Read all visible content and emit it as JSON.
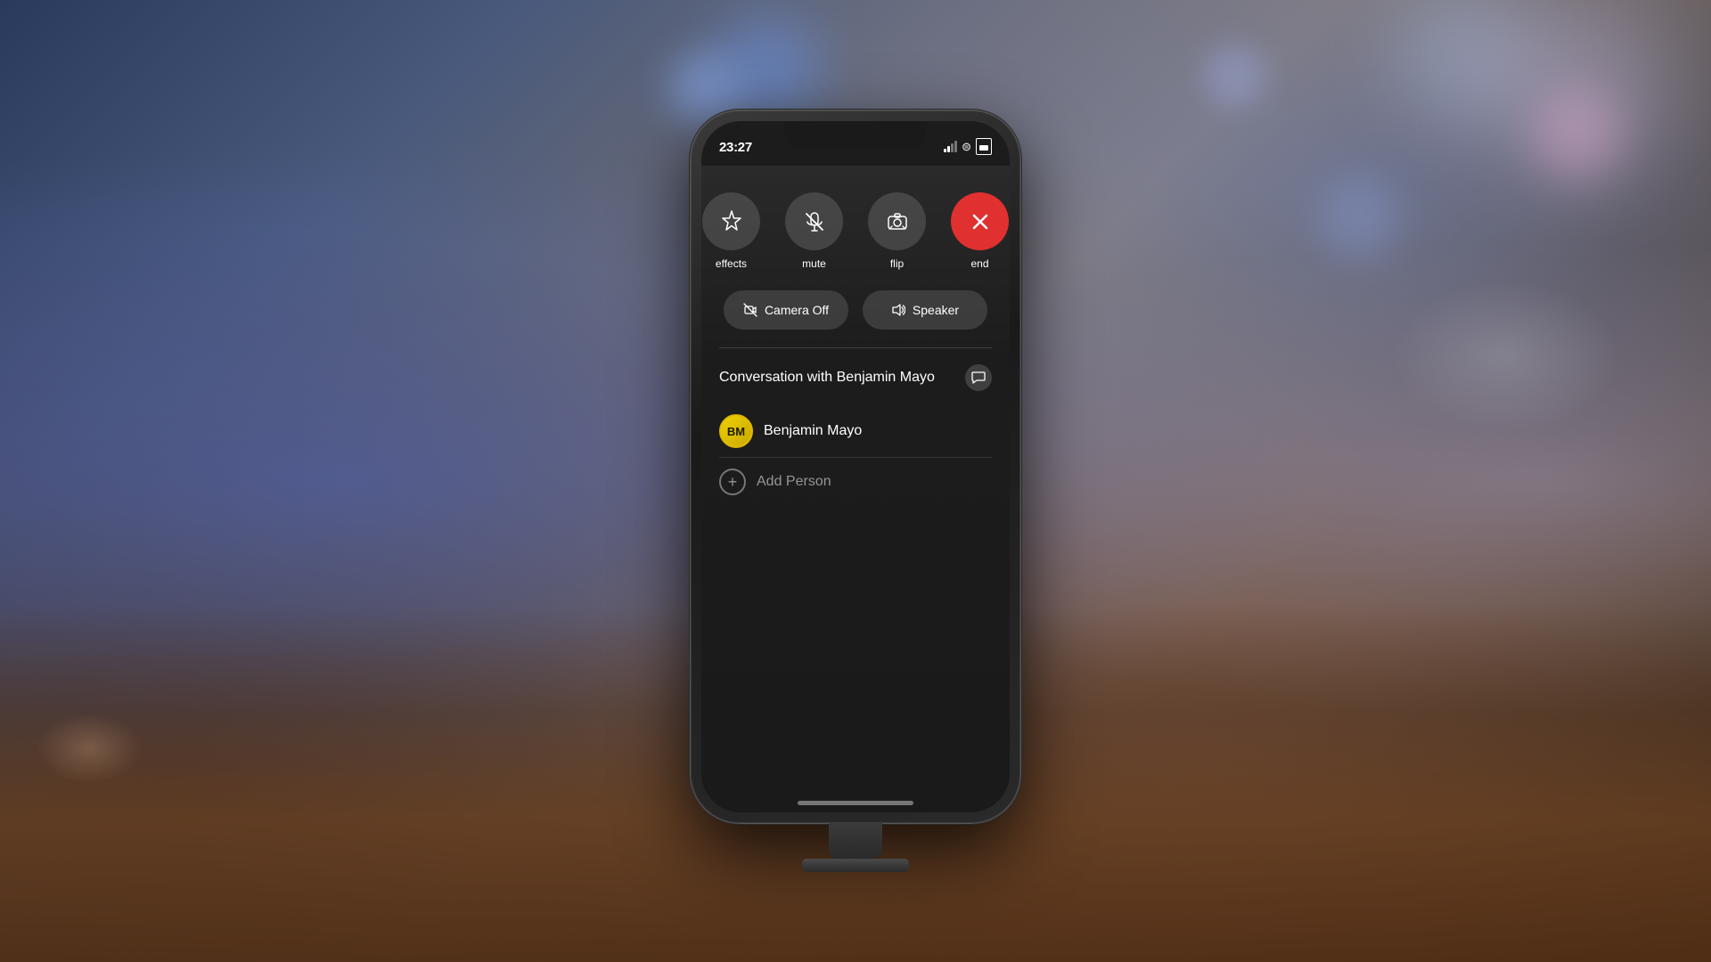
{
  "background": {
    "description": "Blurred bokeh background with wood table surface"
  },
  "phone": {
    "statusBar": {
      "time": "23:27",
      "timeArrow": "↑"
    },
    "pullIndicator": true,
    "controls": [
      {
        "id": "effects",
        "label": "effects",
        "icon": "✦",
        "type": "normal"
      },
      {
        "id": "mute",
        "label": "mute",
        "icon": "🎤",
        "type": "normal",
        "strikethrough": true
      },
      {
        "id": "flip",
        "label": "flip",
        "icon": "📷",
        "type": "normal"
      },
      {
        "id": "end",
        "label": "end",
        "icon": "✕",
        "type": "end"
      }
    ],
    "secondaryButtons": [
      {
        "id": "camera-off",
        "label": "Camera Off",
        "icon": "📷"
      },
      {
        "id": "speaker",
        "label": "Speaker",
        "icon": "🔊"
      }
    ],
    "conversation": {
      "title": "Conversation with Benjamin Mayo",
      "contact": {
        "initials": "BM",
        "name": "Benjamin Mayo"
      },
      "addPerson": "Add Person"
    },
    "homeIndicator": true
  }
}
